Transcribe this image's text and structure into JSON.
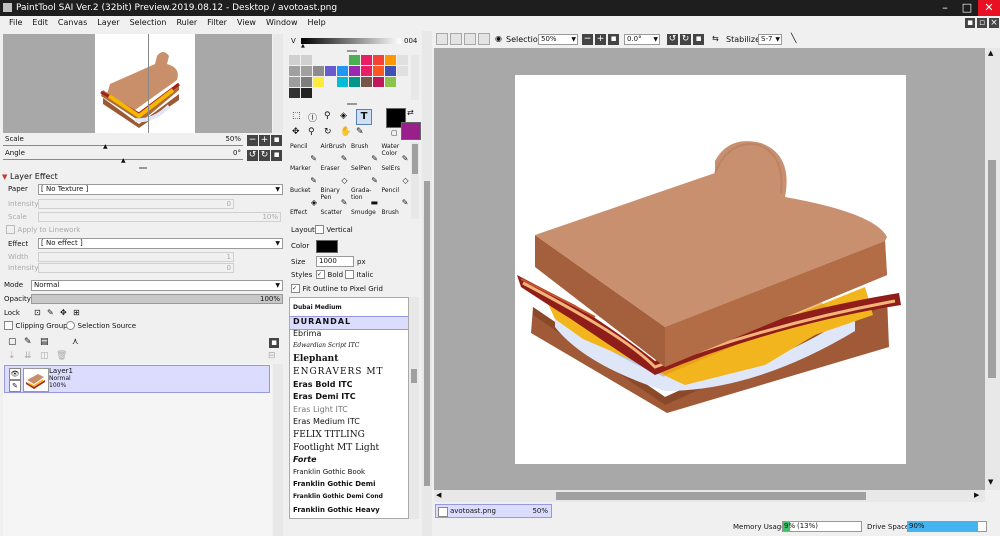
{
  "window": {
    "title": "PaintTool SAI Ver.2 (32bit) Preview.2019.08.12 - Desktop / avotoast.png",
    "minimize": "–",
    "maximize": "□",
    "close": "✕"
  },
  "menu": [
    "File",
    "Edit",
    "Canvas",
    "Layer",
    "Selection",
    "Ruler",
    "Filter",
    "View",
    "Window",
    "Help"
  ],
  "navigator": {
    "scale_label": "Scale",
    "scale_value": "50%",
    "angle_label": "Angle",
    "angle_value": "0°"
  },
  "layer_effect": {
    "header": "Layer Effect",
    "paper_label": "Paper",
    "paper_value": "[ No Texture ]",
    "intensity_label": "Intensity",
    "intensity_value": "0",
    "scale_label": "Scale",
    "scale_value": "10%",
    "apply_linework": "Apply to Linework",
    "effect_label": "Effect",
    "effect_value": "[ No effect ]",
    "width_label": "Width",
    "width_value": "1",
    "intensity2_label": "Intensity",
    "intensity2_value": "0"
  },
  "layer_props": {
    "mode_label": "Mode",
    "mode_value": "Normal",
    "opacity_label": "Opacity",
    "opacity_value": "100%",
    "lock_label": "Lock",
    "clipping_group": "Clipping Group",
    "selection_source": "Selection Source"
  },
  "layer": {
    "name": "Layer1",
    "mode": "Normal",
    "opacity": "100%"
  },
  "color": {
    "v_label": "V",
    "v_value": "004",
    "foreground": "#000000",
    "background_swatch": "#9a1f8a",
    "swatches": [
      "#d0d0d0",
      "#d0d0d0",
      "#f0f0f0",
      "#f0f0f0",
      "#f0f0f0",
      "#4caf50",
      "#e91e63",
      "#f44336",
      "#ff9800",
      "#e0e0e0",
      "#a0a0a0",
      "#a0a0a0",
      "#8c8c8c",
      "#6a5acd",
      "#2196f3",
      "#9c27b0",
      "#e91e63",
      "#ff5722",
      "#3f51b5",
      "#e0e0e0",
      "#9e9e9e",
      "#7e7e7e",
      "#ffeb3b",
      "#f0f0f0",
      "#00bcd4",
      "#009688",
      "#795548",
      "#c2185b",
      "#8bc34a",
      "#f0f0f0",
      "#333333",
      "#222222",
      "#f0f0f0",
      "#f0f0f0",
      "#f0f0f0",
      "#f0f0f0",
      "#f0f0f0",
      "#f0f0f0",
      "#f0f0f0",
      "#f0f0f0"
    ]
  },
  "tools": [
    {
      "name": "Pencil",
      "glyph": "✎"
    },
    {
      "name": "AirBrush",
      "glyph": "✎"
    },
    {
      "name": "Brush",
      "glyph": "✎"
    },
    {
      "name": "Water Color",
      "glyph": "✎"
    },
    {
      "name": "Marker",
      "glyph": "✎"
    },
    {
      "name": "Eraser",
      "glyph": "◇"
    },
    {
      "name": "SelPen",
      "glyph": "✎"
    },
    {
      "name": "SelErs",
      "glyph": "◇"
    },
    {
      "name": "Bucket",
      "glyph": "◈"
    },
    {
      "name": "Binary Pen",
      "glyph": "✎"
    },
    {
      "name": "Grada-tion",
      "glyph": "▬"
    },
    {
      "name": "Pencil",
      "glyph": "✎"
    },
    {
      "name": "Effect",
      "glyph": ""
    },
    {
      "name": "Scatter",
      "glyph": ""
    },
    {
      "name": "Smudge",
      "glyph": ""
    },
    {
      "name": "Brush",
      "glyph": ""
    }
  ],
  "text_tool": {
    "layout_label": "Layout",
    "vertical": "Vertical",
    "color_label": "Color",
    "text_color": "#000000",
    "size_label": "Size",
    "size_value": "1000",
    "size_unit": "px",
    "styles_label": "Styles",
    "bold": "Bold",
    "italic": "Italic",
    "fit_outline": "Fit Outline to Pixel Grid"
  },
  "fonts": [
    {
      "name": "Dubai Medium",
      "style": "font-size:6px;font-weight:bold;"
    },
    {
      "name": "DURANDAL",
      "style": "font-size:8px;font-weight:bold;letter-spacing:1px;"
    },
    {
      "name": "Ebrima",
      "style": "font-size:8px;"
    },
    {
      "name": "Edwardian Script ITC",
      "style": "font-size:6px;font-style:italic;font-family:'DejaVu Serif',serif;"
    },
    {
      "name": "Elephant",
      "style": "font-size:9px;font-weight:bold;font-family:'DejaVu Serif',serif;"
    },
    {
      "name": "ENGRAVERS MT",
      "style": "font-size:9px;letter-spacing:1px;font-family:'DejaVu Serif',serif;"
    },
    {
      "name": "Eras Bold ITC",
      "style": "font-size:8px;font-weight:bold;"
    },
    {
      "name": "Eras Demi ITC",
      "style": "font-size:8px;font-weight:bold;"
    },
    {
      "name": "Eras Light ITC",
      "style": "font-size:8px;color:#777;"
    },
    {
      "name": "Eras Medium ITC",
      "style": "font-size:8px;"
    },
    {
      "name": "FELIX TITLING",
      "style": "font-size:9px;font-family:'DejaVu Serif',serif;"
    },
    {
      "name": "Footlight MT Light",
      "style": "font-size:9px;font-family:'DejaVu Serif',serif;"
    },
    {
      "name": "Forte",
      "style": "font-size:8px;font-weight:bold;font-style:italic;"
    },
    {
      "name": "Franklin Gothic Book",
      "style": "font-size:7px;"
    },
    {
      "name": "Franklin Gothic Demi",
      "style": "font-size:7px;font-weight:bold;"
    },
    {
      "name": "Franklin Gothic Demi Cond",
      "style": "font-size:6px;font-weight:bold;"
    },
    {
      "name": "Franklin Gothic Heavy",
      "style": "font-size:7px;font-weight:bold;"
    }
  ],
  "toolbar": {
    "selection_label": "Selection",
    "zoom_value": "50%",
    "angle_value": "0.0°",
    "stabilizer_label": "Stabilizer",
    "stabilizer_value": "S-7"
  },
  "document_tab": {
    "name": "avotoast.png",
    "zoom": "50%"
  },
  "status": {
    "memory_label": "Memory Usage",
    "memory_value": "9%",
    "memory_detail": "(13%)",
    "memory_fraction": 0.09,
    "drive_label": "Drive Space",
    "drive_value": "90%",
    "drive_fraction": 0.9
  }
}
